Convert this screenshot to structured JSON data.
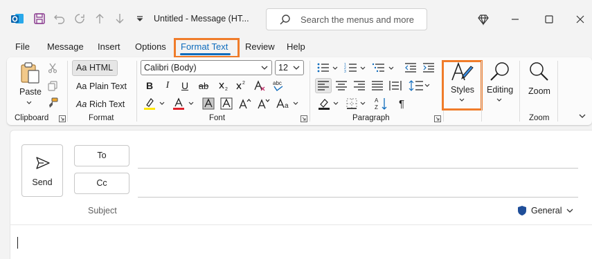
{
  "window": {
    "title": "Untitled  -  Message (HT...",
    "search_placeholder": "Search the menus and more"
  },
  "tabs": [
    {
      "label": "File"
    },
    {
      "label": "Message"
    },
    {
      "label": "Insert"
    },
    {
      "label": "Options"
    },
    {
      "label": "Format Text",
      "active": true
    },
    {
      "label": "Review"
    },
    {
      "label": "Help"
    }
  ],
  "ribbon": {
    "clipboard": {
      "label": "Clipboard",
      "paste_label": "Paste"
    },
    "format": {
      "label": "Format",
      "html": "HTML",
      "plain_text": "Plain Text",
      "rich_text": "Rich Text",
      "glyph": "Aa",
      "selected": "HTML"
    },
    "font": {
      "label": "Font",
      "font_name": "Calibri (Body)",
      "font_size": "12"
    },
    "paragraph": {
      "label": "Paragraph"
    },
    "styles": {
      "label": "Styles"
    },
    "editing": {
      "label": "Editing"
    },
    "zoom": {
      "label": "Zoom",
      "group_label": "Zoom"
    }
  },
  "compose": {
    "send_label": "Send",
    "to_label": "To",
    "cc_label": "Cc",
    "subject_placeholder": "Subject",
    "sensitivity_label": "General"
  },
  "colors": {
    "accent": "#0f6cbd",
    "highlight_box": "#f07c2a",
    "outlook_blue": "#0a64ad",
    "save_purple": "#8a3a8f",
    "sensitivity_shield": "#1f4e99"
  }
}
